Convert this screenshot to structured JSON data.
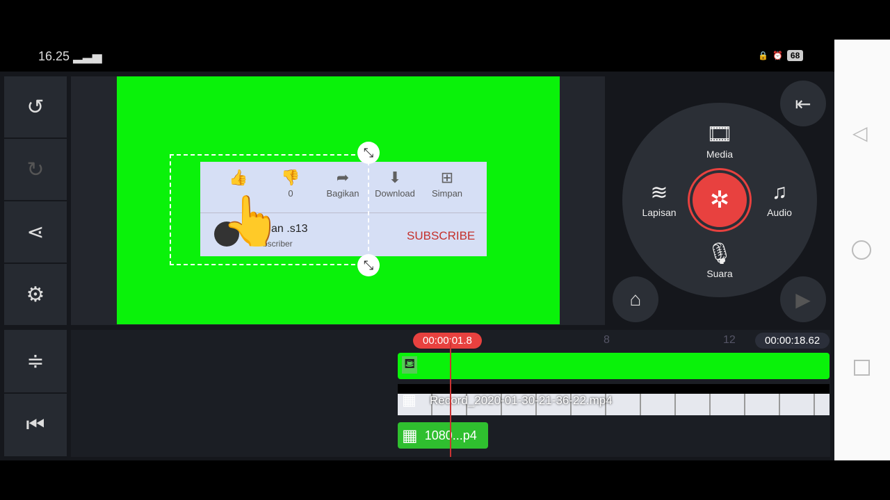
{
  "status": {
    "time": "16.25",
    "signal_icon": "signal-icon",
    "battery": "68"
  },
  "left_toolbar": [
    {
      "icon": "undo-icon",
      "glyph": "↺"
    },
    {
      "icon": "redo-icon",
      "glyph": "↻"
    },
    {
      "icon": "share-icon",
      "glyph": "⋖"
    },
    {
      "icon": "settings-icon",
      "glyph": "⚙"
    }
  ],
  "left_bottom": [
    {
      "icon": "adjust-track-icon",
      "glyph": "≑"
    },
    {
      "icon": "skip-start-icon",
      "glyph": "⏮"
    }
  ],
  "card": {
    "like": "",
    "dislike_count": "0",
    "share": "Bagikan",
    "download": "Download",
    "save": "Simpan",
    "channel": "an .s13",
    "subscriber": "bscriber",
    "subscribe": "SUBSCRIBE"
  },
  "wheel": {
    "media": "Media",
    "layer": "Lapisan",
    "audio": "Audio",
    "voice": "Suara"
  },
  "timeline": {
    "playhead": "00:00:01.8",
    "duration": "00:00:18.62",
    "tick8": "8",
    "tick12": "12",
    "clip_name": "Record_2020-01-30-21-36-22.mp4",
    "clip_short": "1080...p4"
  },
  "colors": {
    "accent": "#e8413f",
    "chroma": "#0af20a"
  }
}
